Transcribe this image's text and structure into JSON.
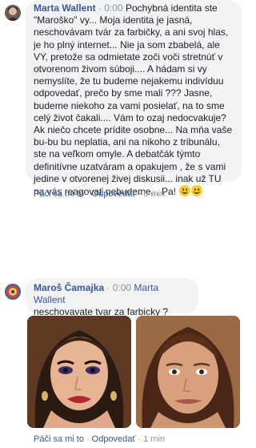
{
  "comments": [
    {
      "author": "Marta Wallent",
      "sep": "· 0:00",
      "text": "Pochybná identita ste \"Maroško\" vy... Moja identita je jasná, neschovávam tvár za farbičky, a ani svoj hlas, je ho plný internet... Nie ja som zbabelá, ale VY, pretože sa odmietate zoči voči stretnúť v otvorenom živom súboji.... A hádam si vy nemyslíte, že tu budeme nejakemu indivíduu odpovedať, prečo by sme mali ??? Jasne, budeme niekoho za vami posielať, na to sme celý život čakali.... Vám to ozaj nedocvakuje? Ak niečo chcete prídite osobne... Na mňa vaše bu-bu bu neplatia, ani na nikoho z tribunálu, ste na veľkom omyle. A debatčák týmto definitívne uzatváram a opakujem , že s vami jedine v otvorenej živej diskusii... inak už TU na vás reagovať nebudeme... Pa!",
      "emoji": [
        "grinning-face-emoji",
        "grinning-face-emoji"
      ],
      "like_label": "Páči sa mi to",
      "reply_label": "Odpovedať",
      "time": "6 min"
    },
    {
      "author": "Maroš Čamajka",
      "sep": "· 0:00",
      "mention": "Marta Wallent",
      "text": "neschovavate tvar za farbicky ?",
      "photos": [
        "photo-woman-heavy-makeup",
        "photo-woman-no-makeup"
      ],
      "like_label": "Páči sa mi to",
      "reply_label": "Odpovedať",
      "time": "1 min"
    }
  ],
  "colors": {
    "link": "#385898",
    "bubble": "#f2f3f5",
    "meta": "#8d949e"
  }
}
